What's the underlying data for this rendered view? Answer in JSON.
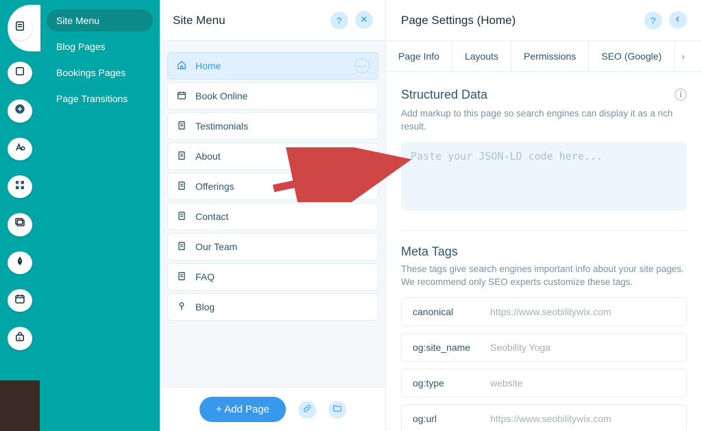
{
  "sidebar": {
    "items": [
      {
        "label": "Site Menu",
        "active": true
      },
      {
        "label": "Blog Pages",
        "active": false
      },
      {
        "label": "Bookings Pages",
        "active": false
      },
      {
        "label": "Page Transitions",
        "active": false
      }
    ]
  },
  "siteMenu": {
    "title": "Site Menu",
    "addPageLabel": "+ Add Page",
    "pages": [
      {
        "label": "Home",
        "icon": "home",
        "selected": true
      },
      {
        "label": "Book Online",
        "icon": "calendar",
        "selected": false
      },
      {
        "label": "Testimonials",
        "icon": "page",
        "selected": false
      },
      {
        "label": "About",
        "icon": "page",
        "selected": false
      },
      {
        "label": "Offerings",
        "icon": "page",
        "selected": false
      },
      {
        "label": "Contact",
        "icon": "page",
        "selected": false
      },
      {
        "label": "Our Team",
        "icon": "page",
        "selected": false
      },
      {
        "label": "FAQ",
        "icon": "page",
        "selected": false
      },
      {
        "label": "Blog",
        "icon": "blog",
        "selected": false
      }
    ]
  },
  "pageSettings": {
    "title": "Page Settings (Home)",
    "tabs": [
      "Page Info",
      "Layouts",
      "Permissions",
      "SEO (Google)"
    ],
    "structured": {
      "heading": "Structured Data",
      "description": "Add markup to this page so search engines can display it as a rich result.",
      "placeholder": "Paste your JSON-LD code here..."
    },
    "metaTags": {
      "heading": "Meta Tags",
      "description": "These tags give search engines important info about your site pages. We recommend only SEO experts customize these tags.",
      "rows": [
        {
          "key": "canonical",
          "value": "https://www.seobilitywix.com"
        },
        {
          "key": "og:site_name",
          "value": "Seobility Yoga"
        },
        {
          "key": "og:type",
          "value": "website"
        },
        {
          "key": "og:url",
          "value": "https://www.seobilitywix.com"
        }
      ]
    }
  }
}
